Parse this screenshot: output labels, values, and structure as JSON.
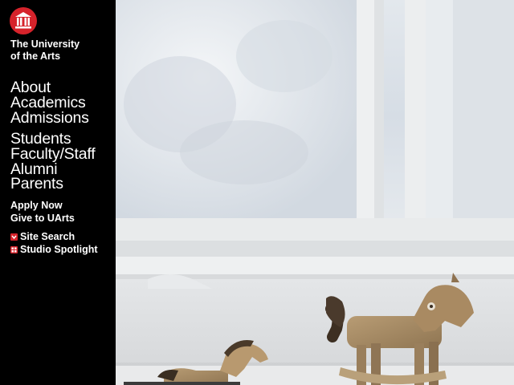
{
  "brand": {
    "name_line1": "The University",
    "name_line2": "of the Arts",
    "logo_color": "#d6232b"
  },
  "primary_nav": [
    {
      "label": "About"
    },
    {
      "label": "Academics"
    },
    {
      "label": "Admissions"
    }
  ],
  "audience_nav": [
    {
      "label": "Students"
    },
    {
      "label": "Faculty/Staff"
    },
    {
      "label": "Alumni"
    },
    {
      "label": "Parents"
    }
  ],
  "secondary_nav": [
    {
      "label": "Apply Now"
    },
    {
      "label": "Give to UArts"
    }
  ],
  "tools": [
    {
      "label": "Site Search",
      "icon": "chevron-down-icon"
    },
    {
      "label": "Studio Spotlight",
      "icon": "grid-icon"
    }
  ],
  "hero": {
    "subject": "wooden toy horses on a windowsill"
  }
}
